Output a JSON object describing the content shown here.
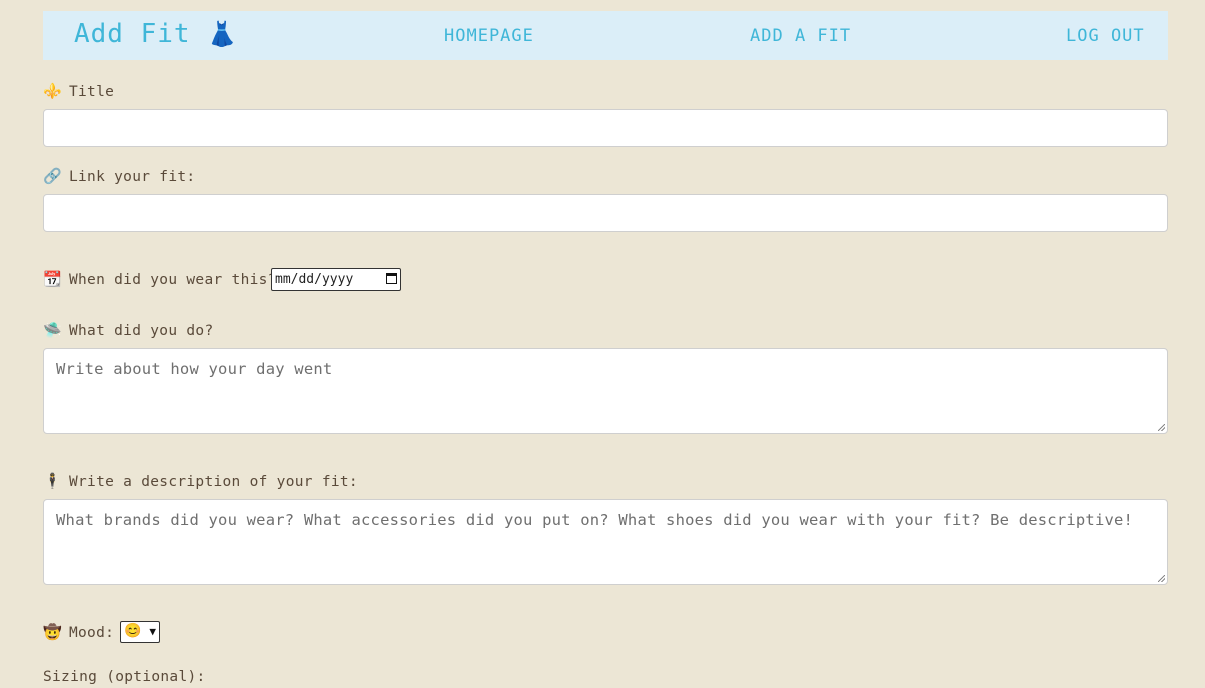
{
  "navbar": {
    "brand": "Add Fit",
    "brand_icon": "👗",
    "links": [
      "HOMEPAGE",
      "ADD A FIT",
      "LOG OUT"
    ]
  },
  "colors": {
    "background": "#ece6d5",
    "navbar_bg": "#dbeef8",
    "accent": "#3fb6d8",
    "text": "#5a4a3a"
  },
  "form": {
    "title": {
      "icon": "⚜️",
      "icon_name": "fleur-de-lis-icon",
      "label": "Title",
      "value": ""
    },
    "link": {
      "icon": "🔗",
      "icon_name": "link-icon",
      "label": "Link your fit:",
      "value": ""
    },
    "date": {
      "icon": "📆",
      "icon_name": "calendar-icon",
      "label": "When did you wear this?",
      "value": "mm/dd/yyyy"
    },
    "activity": {
      "icon": "🛸",
      "icon_name": "ufo-icon",
      "label": "What did you do?",
      "placeholder": "Write about how your day went"
    },
    "description": {
      "icon": "🕴️",
      "icon_name": "levitating-man-icon",
      "label": "Write a description of your fit:",
      "placeholder": "What brands did you wear? What accessories did you put on? What shoes did you wear with your fit? Be descriptive!"
    },
    "mood": {
      "icon": "🤠",
      "icon_name": "cowboy-face-icon",
      "label": "Mood:",
      "selected": "😊"
    },
    "sizing": {
      "label": "Sizing (optional):"
    }
  }
}
